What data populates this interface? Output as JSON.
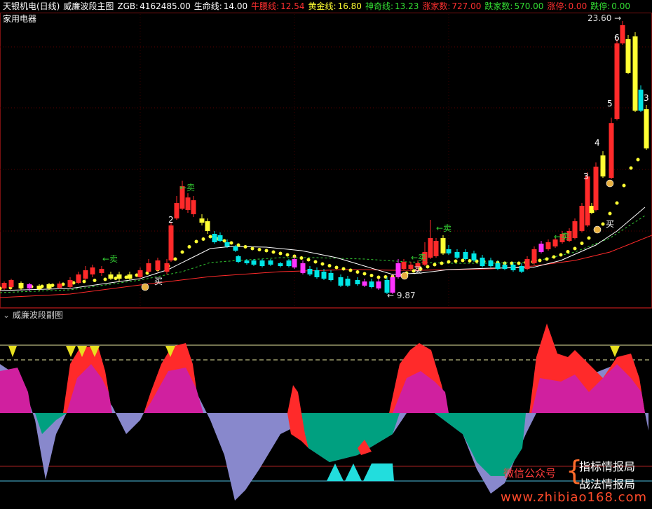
{
  "header": {
    "title": "天银机电(日线)",
    "indicator": "威廉波段主图",
    "zgb_label": "ZGB:",
    "zgb": "4162485.00",
    "shengming_label": "生命线:",
    "shengming": "14.00",
    "niuyao_label": "牛腰线:",
    "niuyao": "12.54",
    "huangjin_label": "黄金线:",
    "huangjin": "16.80",
    "shenqi_label": "神奇线:",
    "shenqi": "13.23",
    "zhangjia_label": "涨家数:",
    "zhangjia": "727.00",
    "diejia_label": "跌家数:",
    "diejia": "570.00",
    "zhangting_label": "涨停:",
    "zhangting": "0.00",
    "dieting_label": "跌停:",
    "dieting": "0.00"
  },
  "sector": "家用电器",
  "sub_panel_title": "威廉波段副图",
  "watermark": {
    "wechat": "微信公众号",
    "line1": "指标情报局",
    "line2": "战法情报局",
    "url": "www.zhibiao168.com"
  },
  "colors": {
    "up": "#ff2a2a",
    "down": "#00e5e5",
    "yellow": "#ffff33",
    "magenta": "#ff33ff",
    "green_line": "#33cc33",
    "white": "#ffffff",
    "teal": "#00a080",
    "purple": "#8888cc",
    "pink": "#d0209f"
  },
  "chart_data": {
    "type": "candlestick",
    "annotations": {
      "sell": [
        "←卖",
        "←卖",
        "←卖",
        "←卖",
        "←卖"
      ],
      "buy": [
        "买",
        "买",
        "买"
      ],
      "nums": [
        "2",
        "3",
        "4",
        "5",
        "6",
        "3"
      ],
      "high_label": "23.60",
      "low_label": "9.87"
    }
  }
}
